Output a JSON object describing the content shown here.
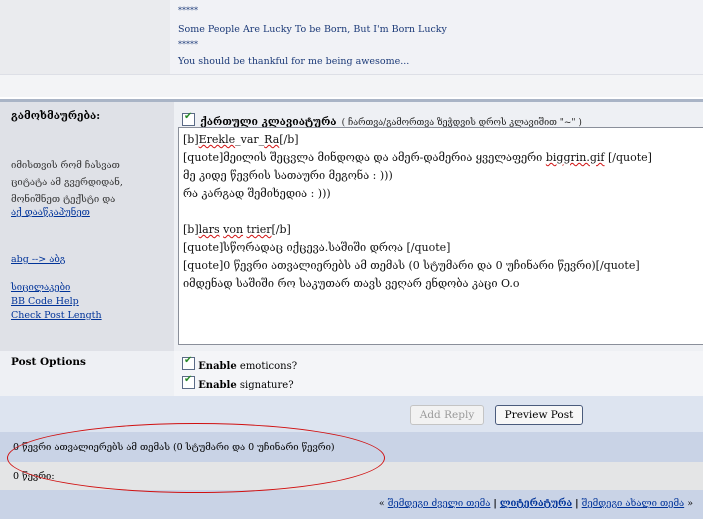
{
  "signature": {
    "stars_1": "*****",
    "line_1": "Some People Are Lucky To be Born, But I'm Born Lucky",
    "stars_2": "*****",
    "line_2": "You should be thankful for me being awesome..."
  },
  "message": {
    "label": "გამოხმაურება:",
    "help_text": [
      "იმისთვის რომ ჩასვათ",
      "ციტატა ამ გვერდიდან,",
      "მონიშნეთ ტექსტი და"
    ],
    "help_link": "აქ დააწკაპუნეთ",
    "translit_link": "abg --> აბგ",
    "smilies_link": "სიცილაკები",
    "bbcode_link": "BB Code Help",
    "check_length_link": "Check Post Length",
    "keyboard_label": "ქართული კლავიატურა",
    "keyboard_hint": "( ჩართვა/გამორთვა ზეჭდვის დროს კლავიშით \"~\" )",
    "textarea_lines": [
      {
        "parts": [
          {
            "t": "[b]"
          },
          {
            "t": "Erekle",
            "s": true
          },
          {
            "t": "_var_"
          },
          {
            "t": "Ra",
            "s": true
          },
          {
            "t": "[/b]"
          }
        ]
      },
      {
        "parts": [
          {
            "t": "[quote]მეილის შეცვლა მინდოდა და ამერ-დამერია ყველაფერი "
          },
          {
            "t": "biggrin.gif",
            "s": true
          },
          {
            "t": " [/quote]"
          }
        ]
      },
      {
        "parts": [
          {
            "t": "მე კიდე წევრის სათაური მეგონა : )))"
          }
        ]
      },
      {
        "parts": [
          {
            "t": "რა კარგად შემიხედია : )))"
          }
        ]
      },
      {
        "parts": [
          {
            "t": ""
          }
        ]
      },
      {
        "parts": [
          {
            "t": "[b]"
          },
          {
            "t": "lars",
            "s": true
          },
          {
            "t": " "
          },
          {
            "t": "von",
            "s": true
          },
          {
            "t": " "
          },
          {
            "t": "trier",
            "s": true
          },
          {
            "t": "[/b]"
          }
        ]
      },
      {
        "parts": [
          {
            "t": "[quote]სწორადაც იქცევა.საშიში დროა [/quote]"
          }
        ]
      },
      {
        "parts": [
          {
            "t": "[quote]0 წევრი ათვალიერებს ამ თემას (0 სტუმარი და 0 უჩინარი წევრი)[/quote]"
          }
        ]
      },
      {
        "parts": [
          {
            "t": "იმდენად საშიში რო საკუთარ თავს ვეღარ ენდობა კაცი O.o"
          }
        ]
      }
    ]
  },
  "options": {
    "label": "Post Options",
    "enable_word": "Enable",
    "emoticons": "emoticons?",
    "signature": "signature?"
  },
  "buttons": {
    "add_reply": "Add Reply",
    "preview": "Preview Post"
  },
  "viewers": {
    "line_1": "0 წევრი ათვალიერებს ამ თემას (0 სტუმარი და 0 უჩინარი წევრი)",
    "line_2": "0 წევრი:"
  },
  "nav": {
    "open": "«",
    "prev": "შემდეგი ძველი თემა",
    "sep": "|",
    "forum": "ლიტერატურა",
    "next": "შემდეგი ახალი თემა",
    "close": "»"
  },
  "colors": {
    "annotation_ellipse": "#d01010",
    "link": "#003399",
    "header_bar": "#a9b4c6"
  }
}
